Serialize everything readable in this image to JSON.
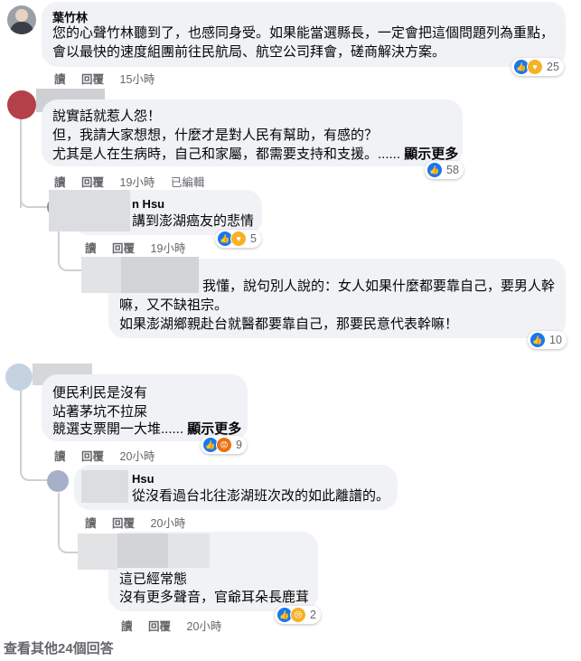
{
  "comments": [
    {
      "author": "葉竹林",
      "lines": [
        "您的心聲竹林聽到了，也感同身受。如果能當選縣長，一定會把這個問題列為重點，",
        "會以最快的速度組團前往民航局、航空公司拜會，磋商解決方案。"
      ],
      "actions": {
        "read": "讀",
        "reply": "回覆",
        "time": "15小時"
      },
      "reactions": {
        "icons": [
          "like-icon",
          "care-icon"
        ],
        "count": "25"
      }
    },
    {
      "author": "",
      "lines": [
        "說實話就惹人怨！",
        "但，我請大家想想，什麼才是對人民有幫助，有感的？",
        "尤其是人在生病時，自己和家屬，都需要支持和支援。......"
      ],
      "see_more": "顯示更多",
      "actions": {
        "read": "讀",
        "reply": "回覆",
        "time": "19小時",
        "edited": "已編輯"
      },
      "reactions": {
        "icons": [
          "like-icon"
        ],
        "count": "58"
      }
    },
    {
      "author_suffix": "n Hsu",
      "lines": [
        "講到澎湖癌友的悲情"
      ],
      "actions": {
        "read": "讀",
        "reply": "回覆",
        "time": "19小時"
      },
      "reactions": {
        "icons": [
          "like-icon",
          "care-icon"
        ],
        "count": "5"
      }
    },
    {
      "author": "",
      "lines": [
        "我懂，說句別人說的：女人如果什麼都要靠自己，要男人幹",
        "嘛，又不缺祖宗。",
        "如果澎湖鄉親赴台就醫都要靠自己，那要民意代表幹嘛！"
      ],
      "reactions": {
        "icons": [
          "like-icon"
        ],
        "count": "10"
      }
    },
    {
      "author": "",
      "lines": [
        "便民利民是沒有",
        "站著茅坑不拉屎",
        "競選支票開一大堆......"
      ],
      "see_more": "顯示更多",
      "actions": {
        "read": "讀",
        "reply": "回覆",
        "time": "20小時"
      },
      "reactions": {
        "icons": [
          "like-icon",
          "angry-icon"
        ],
        "count": "9"
      }
    },
    {
      "author": "Hsu",
      "lines": [
        "從沒看過台北往澎湖班次改的如此離譜的。"
      ],
      "actions": {
        "read": "讀",
        "reply": "回覆",
        "time": "20小時"
      }
    },
    {
      "author": "",
      "lines": [
        "這已經常態",
        "沒有更多聲音，官爺耳朵長鹿茸"
      ],
      "actions": {
        "read": "讀",
        "reply": "回覆",
        "time": "20小時"
      },
      "reactions": {
        "icons": [
          "like-icon",
          "sad-icon"
        ],
        "count": "2"
      }
    }
  ],
  "footer": {
    "more_replies": "查看其他24個回答"
  },
  "colors": {
    "like": "#1877f2",
    "care": "#f7b125",
    "angry": "#e9710f",
    "bubble": "#f0f2f5",
    "meta": "#65676b"
  }
}
